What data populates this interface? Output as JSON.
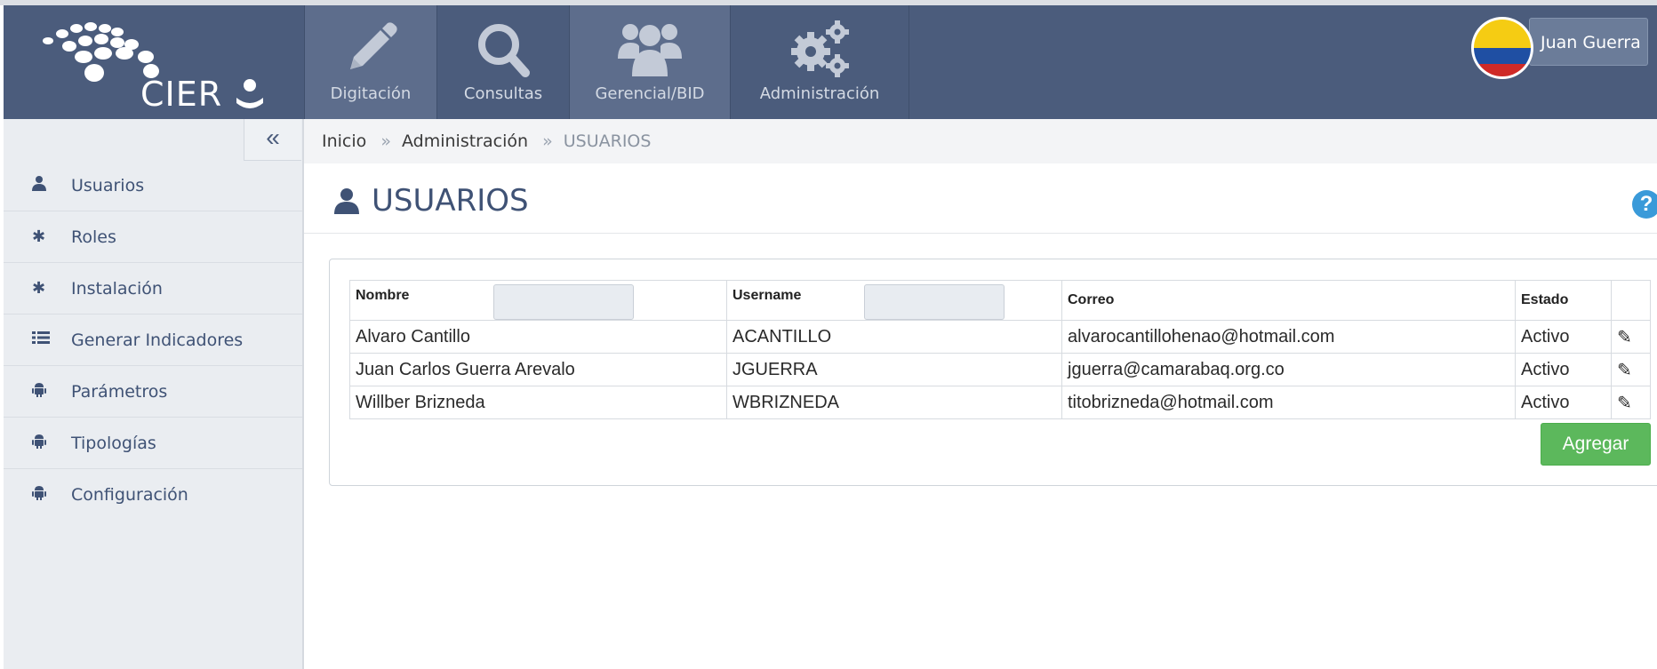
{
  "brand": {
    "name": "CIER"
  },
  "nav": {
    "tabs": [
      {
        "label": "Digitación",
        "icon": "pencil-icon"
      },
      {
        "label": "Consultas",
        "icon": "search-icon"
      },
      {
        "label": "Gerencial/BID",
        "icon": "users-icon"
      },
      {
        "label": "Administración",
        "icon": "gears-icon"
      }
    ],
    "user": {
      "name": "Juan Guerra",
      "flag": "colombia-flag"
    }
  },
  "sidebar": {
    "collapse_label": "«",
    "items": [
      {
        "label": "Usuarios",
        "icon": "user-icon"
      },
      {
        "label": "Roles",
        "icon": "asterisk-icon"
      },
      {
        "label": "Instalación",
        "icon": "asterisk-icon"
      },
      {
        "label": "Generar Indicadores",
        "icon": "list-icon"
      },
      {
        "label": "Parámetros",
        "icon": "android-icon"
      },
      {
        "label": "Tipologías",
        "icon": "android-icon"
      },
      {
        "label": "Configuración",
        "icon": "android-icon"
      }
    ]
  },
  "breadcrumb": {
    "home": "Inicio",
    "sep": "»",
    "section": "Administración",
    "current": "USUARIOS"
  },
  "page": {
    "title": "USUARIOS",
    "help": "?"
  },
  "table": {
    "columns": [
      "Nombre",
      "Username",
      "Correo",
      "Estado"
    ],
    "rows": [
      {
        "nombre": "Alvaro Cantillo",
        "username": "ACANTILLO",
        "correo": "alvarocantillohenao@hotmail.com",
        "estado": "Activo"
      },
      {
        "nombre": "Juan Carlos Guerra Arevalo",
        "username": "JGUERRA",
        "correo": "jguerra@camarabaq.org.co",
        "estado": "Activo"
      },
      {
        "nombre": "Willber Brizneda",
        "username": "WBRIZNEDA",
        "correo": "titobrizneda@hotmail.com",
        "estado": "Activo"
      }
    ],
    "filters": {
      "nombre": "",
      "username": ""
    }
  },
  "actions": {
    "add_label": "Agregar"
  },
  "colors": {
    "navbar": "#4b5c7c",
    "sidebar": "#eaedf1",
    "accent": "#3f5275",
    "add": "#5cb85c",
    "help": "#3a9ad9"
  }
}
